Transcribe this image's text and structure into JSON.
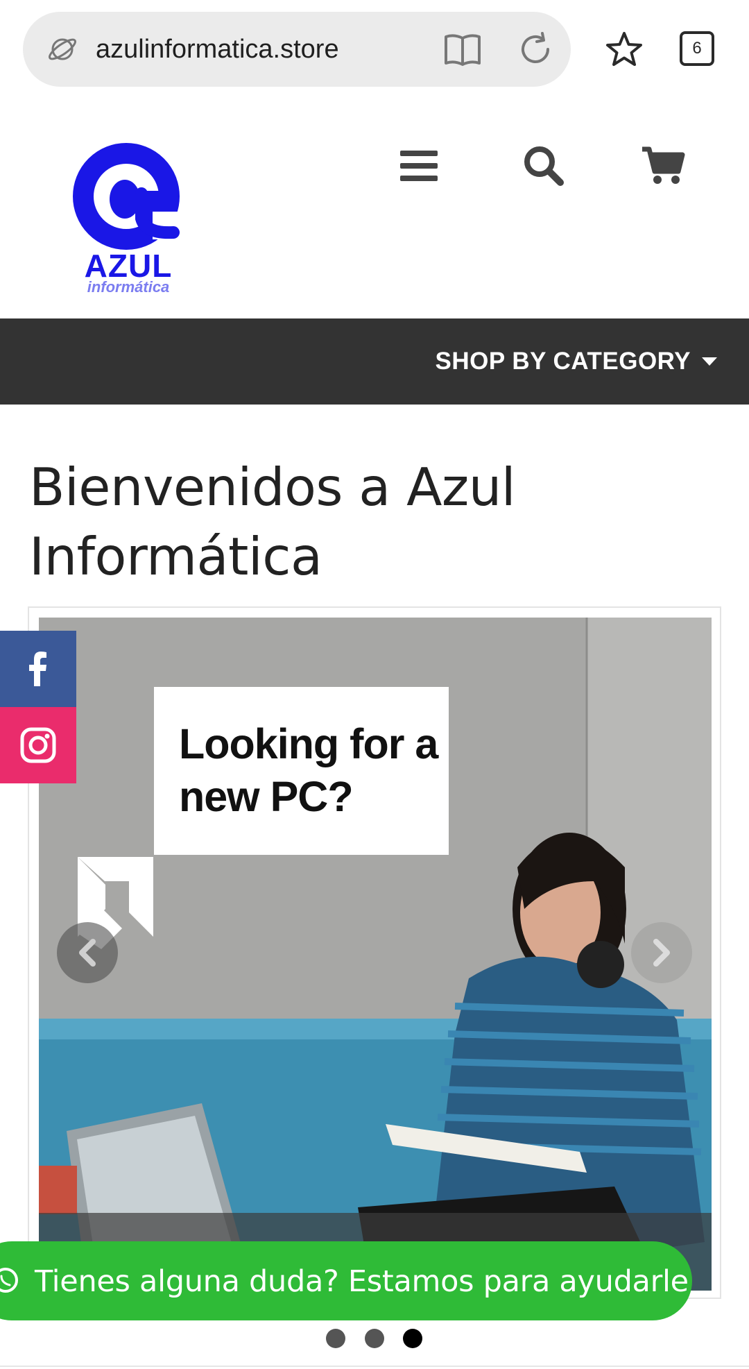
{
  "browser": {
    "url": "azulinformatica.store",
    "tab_count": "6",
    "icons": [
      "site-info-icon",
      "reader-mode-icon",
      "reload-icon",
      "bookmark-star-icon",
      "tabs-icon"
    ]
  },
  "header": {
    "logo_text": "AZUL",
    "logo_subtext": "informática",
    "logo_color": "#1a17e6",
    "icons": [
      "menu-icon",
      "search-icon",
      "cart-icon"
    ]
  },
  "category_bar": {
    "label": "SHOP BY CATEGORY",
    "background": "#333333"
  },
  "main": {
    "title": "Bienvenidos a Azul Informática"
  },
  "carousel": {
    "slide_text": "Looking for a new PC?",
    "active_index": 3,
    "dot_count": 3
  },
  "social": {
    "facebook_color": "#3b5998",
    "instagram_color": "#ea2c6c"
  },
  "chat": {
    "label": "Tienes alguna duda? Estamos para ayudarle",
    "color": "#2fbb37"
  }
}
